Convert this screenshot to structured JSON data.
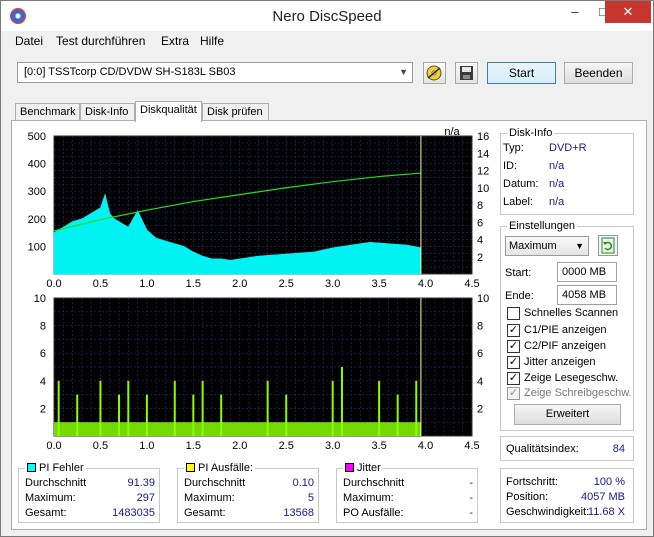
{
  "window": {
    "title": "Nero DiscSpeed",
    "min": "–",
    "max": "□",
    "close": "✕"
  },
  "menu": [
    "Datei",
    "Test durchführen",
    "Extra",
    "Hilfe"
  ],
  "toolbar": {
    "drive": "[0:0]   TSSTcorp CD/DVDW SH-S183L SB03",
    "start_label": "Start",
    "end_label": "Beenden"
  },
  "tabs": [
    "Benchmark",
    "Disk-Info",
    "Diskqualität",
    "Disk prüfen"
  ],
  "disk_info": {
    "title": "Disk-Info",
    "rows": [
      {
        "k": "Typ:",
        "v": "DVD+R"
      },
      {
        "k": "ID:",
        "v": "n/a"
      },
      {
        "k": "Datum:",
        "v": "n/a"
      },
      {
        "k": "Label:",
        "v": "n/a"
      }
    ]
  },
  "settings": {
    "title": "Einstellungen",
    "mode": "Maximum",
    "start_label": "Start:",
    "start_value": "0000 MB",
    "end_label": "Ende:",
    "end_value": "4058 MB",
    "checkboxes": [
      {
        "label": "Schnelles Scannen",
        "checked": false,
        "mark": ""
      },
      {
        "label": "C1/PIE anzeigen",
        "checked": true,
        "mark": "✓"
      },
      {
        "label": "C2/PIF anzeigen",
        "checked": true,
        "mark": "✓"
      },
      {
        "label": "Jitter anzeigen",
        "checked": true,
        "mark": "✓"
      },
      {
        "label": "Zeige Lesegeschw.",
        "checked": true,
        "mark": "✓"
      },
      {
        "label": "Zeige Schreibgeschw.",
        "checked": true,
        "mark": "✓",
        "disabled": true
      }
    ],
    "advanced_label": "Erweitert"
  },
  "quality": {
    "label": "Qualitätsindex:",
    "value": "84"
  },
  "progress": {
    "rows": [
      {
        "k": "Fortschritt:",
        "v": "100 %"
      },
      {
        "k": "Position:",
        "v": "4057 MB"
      },
      {
        "k": "Geschwindigkeit:",
        "v": "11.68 X"
      }
    ]
  },
  "stats": {
    "pi_errors": {
      "title": "PI Fehler",
      "color": "#00ffff",
      "rows": [
        {
          "k": "Durchschnitt",
          "v": "91.39"
        },
        {
          "k": "Maximum:",
          "v": "297"
        },
        {
          "k": "Gesamt:",
          "v": "1483035"
        }
      ]
    },
    "pi_failures": {
      "title": "PI Ausfälle:",
      "color": "#ffff00",
      "rows": [
        {
          "k": "Durchschnitt",
          "v": "0.10"
        },
        {
          "k": "Maximum:",
          "v": "5"
        },
        {
          "k": "Gesamt:",
          "v": "13568"
        }
      ]
    },
    "jitter": {
      "title": "Jitter",
      "color": "#ff00ff",
      "rows": [
        {
          "k": "Durchschnitt",
          "v": "-"
        },
        {
          "k": "Maximum:",
          "v": "-"
        },
        {
          "k": "PO Ausfälle:",
          "v": "-"
        }
      ]
    }
  },
  "chart_data": [
    {
      "type": "area",
      "title": "",
      "top_right_label": "n/a",
      "x_ticks": [
        "0.0",
        "0.5",
        "1.0",
        "1.5",
        "2.0",
        "2.5",
        "3.0",
        "3.5",
        "4.0",
        "4.5"
      ],
      "y_left_ticks": [
        "100",
        "200",
        "300",
        "400",
        "500"
      ],
      "y_right_ticks": [
        "2",
        "4",
        "6",
        "8",
        "10",
        "12",
        "14",
        "16"
      ],
      "xlim": [
        0,
        4.5
      ],
      "ylim": [
        0,
        500
      ],
      "y2lim": [
        0,
        16
      ],
      "series": [
        {
          "name": "PI Fehler",
          "color": "#00ffff",
          "x": [
            0,
            0.1,
            0.2,
            0.3,
            0.4,
            0.5,
            0.55,
            0.6,
            0.65,
            0.7,
            0.8,
            0.9,
            1.0,
            1.1,
            1.2,
            1.3,
            1.4,
            1.5,
            1.6,
            1.7,
            1.8,
            1.9,
            2.0,
            2.2,
            2.4,
            2.6,
            2.8,
            3.0,
            3.2,
            3.4,
            3.6,
            3.8,
            3.95
          ],
          "values": [
            150,
            170,
            190,
            200,
            220,
            240,
            290,
            220,
            200,
            190,
            170,
            230,
            160,
            130,
            120,
            110,
            100,
            80,
            65,
            55,
            55,
            50,
            55,
            65,
            70,
            75,
            80,
            95,
            105,
            115,
            110,
            105,
            95
          ]
        },
        {
          "name": "Lesegeschw.",
          "color": "#22dd22",
          "axis": "right",
          "x": [
            0,
            0.5,
            1.0,
            1.5,
            2.0,
            2.5,
            3.0,
            3.5,
            3.95
          ],
          "values": [
            5.0,
            6.3,
            7.4,
            8.4,
            9.2,
            10.0,
            10.7,
            11.3,
            11.7
          ]
        }
      ],
      "end_marker_x": 3.95
    },
    {
      "type": "bar",
      "title": "",
      "x_ticks": [
        "0.0",
        "0.5",
        "1.0",
        "1.5",
        "2.0",
        "2.5",
        "3.0",
        "3.5",
        "4.0",
        "4.5"
      ],
      "y_left_ticks": [
        "2",
        "4",
        "6",
        "8",
        "10"
      ],
      "y_right_ticks": [
        "2",
        "4",
        "6",
        "8",
        "10"
      ],
      "xlim": [
        0,
        4.5
      ],
      "ylim": [
        0,
        10
      ],
      "series": [
        {
          "name": "PI Ausfälle",
          "color": "#88ff00",
          "x": [
            0.05,
            0.25,
            0.5,
            0.7,
            0.8,
            1.0,
            1.3,
            1.5,
            1.6,
            1.8,
            2.3,
            2.5,
            3.0,
            3.1,
            3.5,
            3.7,
            3.9
          ],
          "values": [
            4,
            3,
            4,
            3,
            4,
            3,
            4,
            3,
            4,
            3,
            4,
            3,
            4,
            5,
            4,
            3,
            4
          ]
        }
      ],
      "baseline_level": 1,
      "end_marker_x": 3.95
    }
  ]
}
